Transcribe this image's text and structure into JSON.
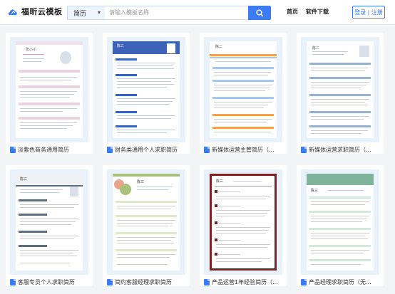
{
  "header": {
    "logo_text": "福昕云模板",
    "search": {
      "category": "简历",
      "placeholder": "请输入模板名称"
    },
    "nav": {
      "home": "首页",
      "software": "软件下载"
    },
    "login": "登录 | 注册"
  },
  "colors": {
    "accent": "#3b7cf2"
  },
  "templates": [
    {
      "title": "淡紫色商务通用简历",
      "name_text": "张小小",
      "theme": "#c9a6b8"
    },
    {
      "title": "财务类通用个人求职简历",
      "name_text": "陈三",
      "theme": "#3d63b8"
    },
    {
      "title": "新媒体运营主管简历（...",
      "name_text": "陈二",
      "theme": "#f0a255"
    },
    {
      "title": "新媒体运营求职简历（...",
      "name_text": "陈二",
      "theme": "#9ab0c8"
    },
    {
      "title": "客服专员个人求职简历",
      "name_text": "陈三",
      "theme": "#5f6e7d"
    },
    {
      "title": "简约客服经理求职简历",
      "name_text": "陈三",
      "theme": "#a8c07a"
    },
    {
      "title": "产品运营1年经验简历（...",
      "name_text": "陈三",
      "theme": "#7a2222"
    },
    {
      "title": "产品经理求职简历（无...",
      "name_text": "陈三",
      "theme": "#7fb49b"
    }
  ]
}
